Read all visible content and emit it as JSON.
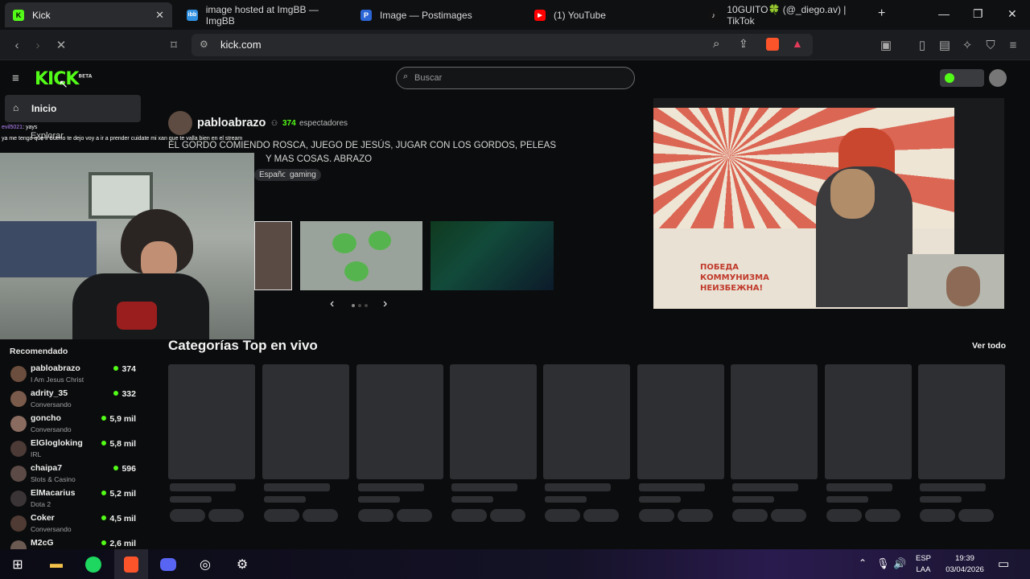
{
  "browser": {
    "tabs": [
      {
        "title": "Kick",
        "fav": "K",
        "favColor": "#53fc18",
        "active": true
      },
      {
        "title": "image hosted at ImgBB — ImgBB",
        "fav": "ibb",
        "favColor": "#2f8fe0"
      },
      {
        "title": "Image — Postimages",
        "fav": "P",
        "favColor": "#2c66d6"
      },
      {
        "title": "(1) YouTube",
        "fav": "▶",
        "favColor": "#ff0000"
      },
      {
        "title": "10GUITO🍀 (@_diego.av) | TikTok",
        "fav": "♪",
        "favColor": "#111111"
      }
    ],
    "new_tab": "+",
    "url": "kick.com"
  },
  "kick": {
    "logo": "KICK",
    "logo_sup": "BETA",
    "search_placeholder": "Buscar",
    "nav_home": "Inicio",
    "nav_explore": "Explorar",
    "chat_lines": [
      {
        "user": "evil5021",
        "text": ": yays"
      },
      {
        "user": "",
        "text": "ya me tengo que ir bueno te dejo voy a ir a prender cuidate mi xan que te valla bien en el stream"
      }
    ],
    "featured": {
      "streamer": "pabloabrazo",
      "viewers": "374",
      "viewers_label": "espectadores",
      "title": "EL GORDO COMIENDO ROSCA, JUEGO DE JESÚS, JUGAR CON LOS GORDOS, PELEAS",
      "title2": "Y MAS COSAS. ABRAZO",
      "tags": [
        "Español",
        "gaming"
      ]
    },
    "poster_text": [
      "ПОБЕДА",
      "КОММУНИЗМА",
      "НЕИЗБЕЖНА!"
    ],
    "carousel_prev": "‹",
    "carousel_next": "›",
    "section_title": "Categorías Top en vivo",
    "see_all": "Ver todo",
    "sidebar_heading": "Recomendado",
    "recommended": [
      {
        "name": "pabloabrazo",
        "category": "I Am Jesus Christ",
        "viewers": "374"
      },
      {
        "name": "adrity_35",
        "category": "Conversando",
        "viewers": "332"
      },
      {
        "name": "goncho",
        "category": "Conversando",
        "viewers": "5,9 mil"
      },
      {
        "name": "ElGlogloking",
        "category": "IRL",
        "viewers": "5,8 mil"
      },
      {
        "name": "chaipa7",
        "category": "Slots & Casino",
        "viewers": "596"
      },
      {
        "name": "ElMacarius",
        "category": "Dota 2",
        "viewers": "5,2 mil"
      },
      {
        "name": "Coker",
        "category": "Conversando",
        "viewers": "4,5 mil"
      },
      {
        "name": "M2cG",
        "category": "",
        "viewers": "2,6 mil"
      }
    ]
  },
  "taskbar": {
    "lang": "ESP",
    "layout": "LAA",
    "time": "19:39",
    "date": "03/04/2026"
  },
  "colors": {
    "kick_green": "#53fc18",
    "bg": "#0b0c0d"
  }
}
